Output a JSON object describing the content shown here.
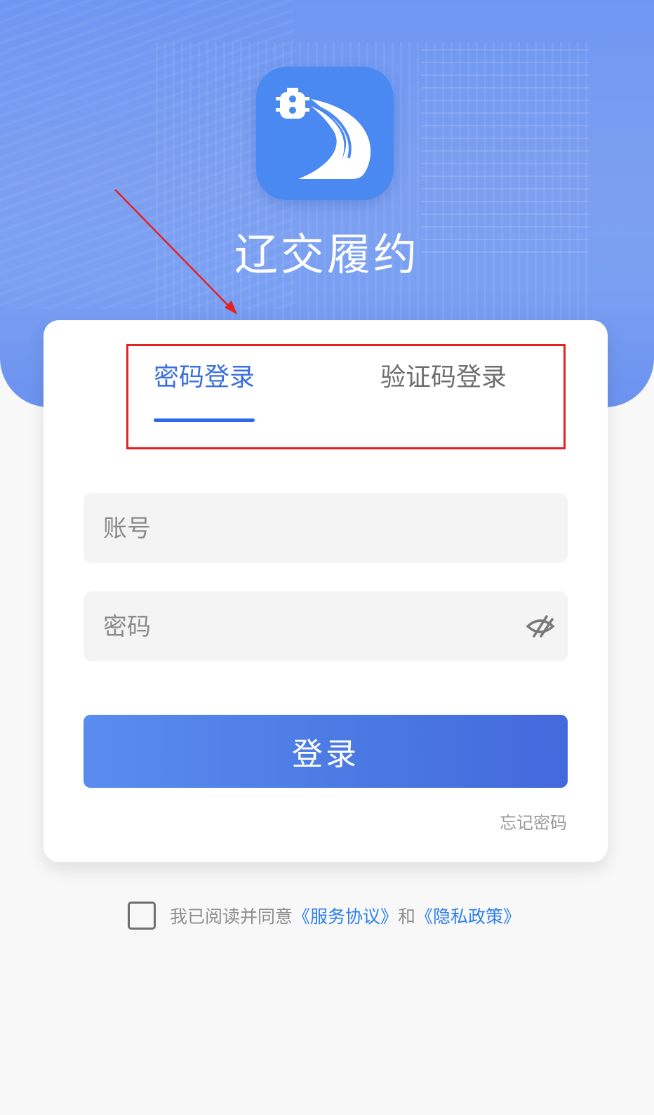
{
  "app": {
    "title": "辽交履约",
    "icon": "traffic-road-logo-icon"
  },
  "tabs": [
    {
      "label": "密码登录",
      "active": true
    },
    {
      "label": "验证码登录",
      "active": false
    }
  ],
  "form": {
    "account_placeholder": "账号",
    "password_placeholder": "密码",
    "login_label": "登录",
    "forgot_label": "忘记密码"
  },
  "agreement": {
    "prefix": "我已阅读并同意",
    "service_link": "《服务协议》",
    "and": "和",
    "privacy_link": "《隐私政策》"
  },
  "colors": {
    "accent": "#2a6ae8",
    "annotation": "#e52222",
    "link": "#2f7ff0"
  }
}
